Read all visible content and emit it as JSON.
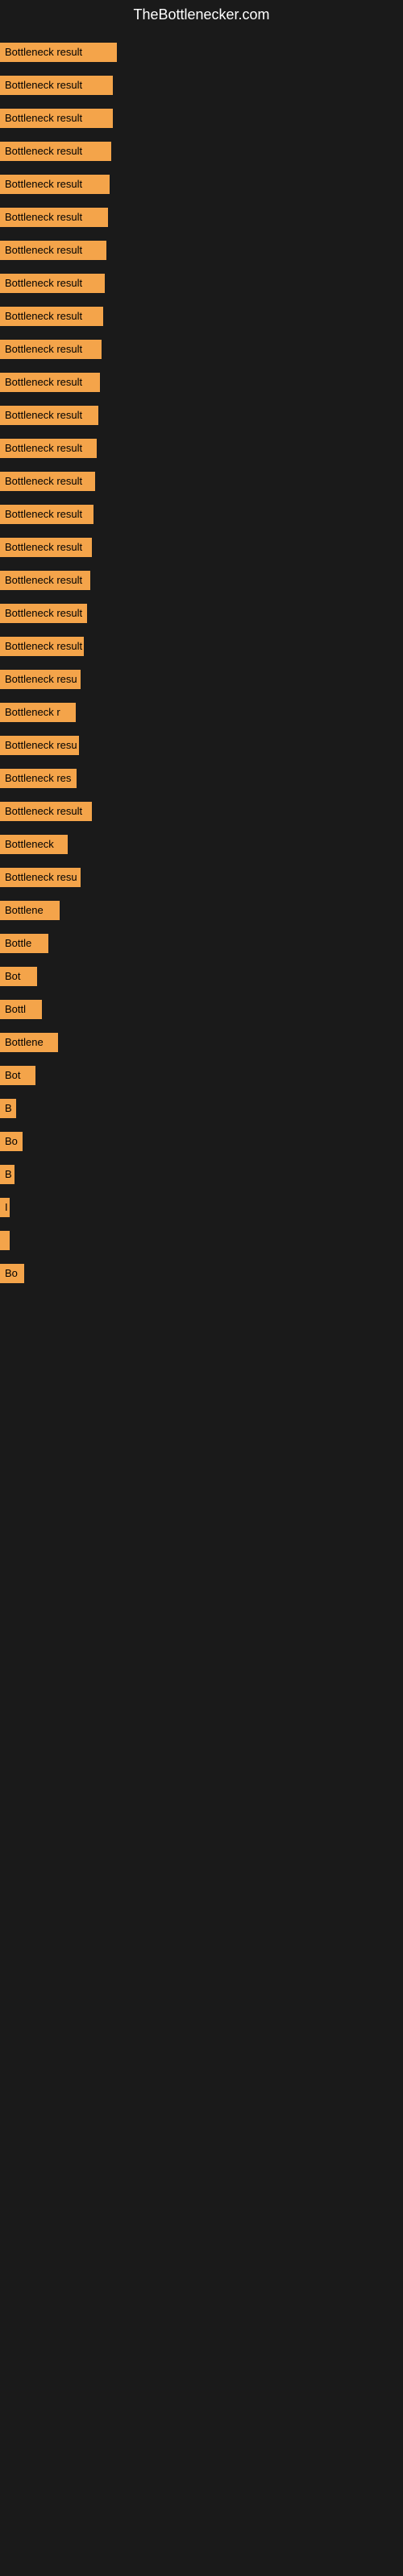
{
  "site_title": "TheBottlenecker.com",
  "bars": [
    {
      "label": "Bottleneck result",
      "width": 145
    },
    {
      "label": "Bottleneck result",
      "width": 140
    },
    {
      "label": "Bottleneck result",
      "width": 140
    },
    {
      "label": "Bottleneck result",
      "width": 138
    },
    {
      "label": "Bottleneck result",
      "width": 136
    },
    {
      "label": "Bottleneck result",
      "width": 134
    },
    {
      "label": "Bottleneck result",
      "width": 132
    },
    {
      "label": "Bottleneck result",
      "width": 130
    },
    {
      "label": "Bottleneck result",
      "width": 128
    },
    {
      "label": "Bottleneck result",
      "width": 126
    },
    {
      "label": "Bottleneck result",
      "width": 124
    },
    {
      "label": "Bottleneck result",
      "width": 122
    },
    {
      "label": "Bottleneck result",
      "width": 120
    },
    {
      "label": "Bottleneck result",
      "width": 118
    },
    {
      "label": "Bottleneck result",
      "width": 116
    },
    {
      "label": "Bottleneck result",
      "width": 114
    },
    {
      "label": "Bottleneck result",
      "width": 112
    },
    {
      "label": "Bottleneck result",
      "width": 108
    },
    {
      "label": "Bottleneck result",
      "width": 104
    },
    {
      "label": "Bottleneck resu",
      "width": 100
    },
    {
      "label": "Bottleneck r",
      "width": 94
    },
    {
      "label": "Bottleneck resu",
      "width": 98
    },
    {
      "label": "Bottleneck res",
      "width": 95
    },
    {
      "label": "Bottleneck result",
      "width": 114
    },
    {
      "label": "Bottleneck",
      "width": 84
    },
    {
      "label": "Bottleneck resu",
      "width": 100
    },
    {
      "label": "Bottlene",
      "width": 74
    },
    {
      "label": "Bottle",
      "width": 60
    },
    {
      "label": "Bot",
      "width": 46
    },
    {
      "label": "Bottl",
      "width": 52
    },
    {
      "label": "Bottlene",
      "width": 72
    },
    {
      "label": "Bot",
      "width": 44
    },
    {
      "label": "B",
      "width": 20
    },
    {
      "label": "Bo",
      "width": 28
    },
    {
      "label": "B",
      "width": 18
    },
    {
      "label": "I",
      "width": 10
    },
    {
      "label": "",
      "width": 6
    },
    {
      "label": "Bo",
      "width": 30
    }
  ],
  "colors": {
    "bar_fill": "#f4a44a",
    "background": "#1a1a1a",
    "title": "#ffffff"
  }
}
